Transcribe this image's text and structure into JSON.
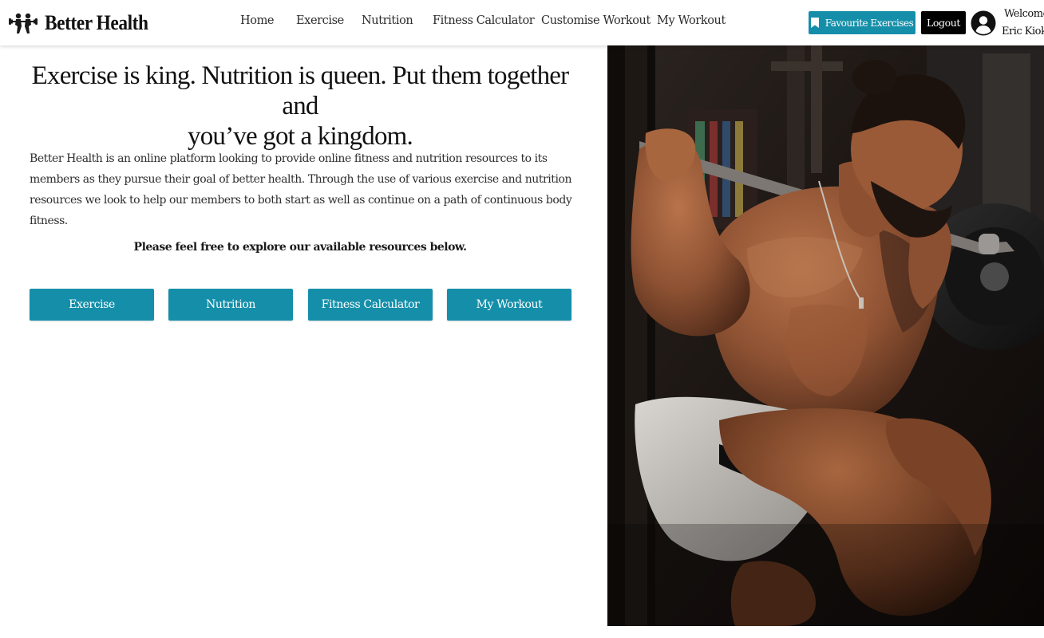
{
  "brand": {
    "name": "Better Health"
  },
  "nav": {
    "links": [
      "Home",
      "Exercise",
      "Nutrition",
      "Fitness Calculator",
      "Customise Workout",
      "My Workout"
    ]
  },
  "account": {
    "favourites_label": "Favourite Exercises",
    "logout_label": "Logout",
    "welcome_line1": "Welcome",
    "welcome_line2": "Eric Kioko"
  },
  "hero": {
    "headline_line1": "Exercise is king. Nutrition is queen. Put them together and",
    "headline_line2": "you’ve got a kingdom.",
    "intro": "Better Health is an online platform looking to provide online fitness and nutrition resources to its members as they pursue their goal of better health. Through the use of various exercise and nutrition resources we look to help our members to both start as well as continue on a path of continuous body fitness.",
    "explore": "Please feel free to explore our available resources below."
  },
  "resources": {
    "buttons": [
      "Exercise",
      "Nutrition",
      "Fitness Calculator",
      "My Workout"
    ]
  },
  "colors": {
    "accent": "#158fa9",
    "logout": "#000000",
    "text": "#1a1a1a"
  },
  "icons": {
    "logo": "dumbbell-figures-logo",
    "favourites": "bookmark-icon",
    "user": "user-circle-icon"
  }
}
